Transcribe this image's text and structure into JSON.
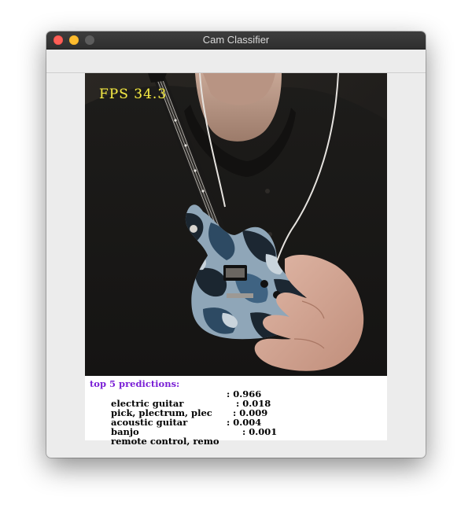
{
  "window": {
    "title": "Cam Classifier"
  },
  "camera": {
    "fps_text": "FPS 34.3"
  },
  "predictions": {
    "title": "top 5 predictions:",
    "items": [
      {
        "label": "electric guitar",
        "score": ": 0.966"
      },
      {
        "label": "pick, plectrum, plec",
        "score": ": 0.018"
      },
      {
        "label": "acoustic guitar",
        "score": ": 0.009"
      },
      {
        "label": "banjo",
        "score": ": 0.004"
      },
      {
        "label": "remote control, remo",
        "score": ": 0.001"
      }
    ]
  },
  "colors": {
    "close": "#fe5f57",
    "minimize": "#febc2e",
    "zoom_disabled": "#5d5d5d",
    "fps_overlay": "#f2e84a",
    "predictions_title": "#7a1fd6"
  }
}
